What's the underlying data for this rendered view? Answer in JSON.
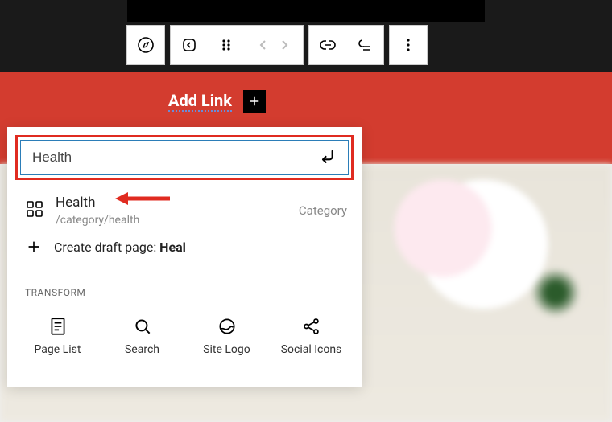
{
  "header": {
    "add_link_label": "Add Link"
  },
  "toolbar": {
    "compass": "compass-icon",
    "back": "back-icon",
    "drag": "drag-handle-icon",
    "prev": "chevron-left-icon",
    "next": "chevron-right-icon",
    "link": "link-icon",
    "submenu": "submenu-icon",
    "more": "more-options-icon"
  },
  "popup": {
    "search_value": "Health",
    "result": {
      "title": "Health",
      "path": "/category/health",
      "type_label": "Category"
    },
    "create_draft_prefix": "Create draft page: ",
    "create_draft_term": "Heal",
    "transform_heading": "TRANSFORM",
    "transforms": {
      "page_list": "Page List",
      "search": "Search",
      "site_logo": "Site Logo",
      "social_icons": "Social Icons"
    }
  }
}
